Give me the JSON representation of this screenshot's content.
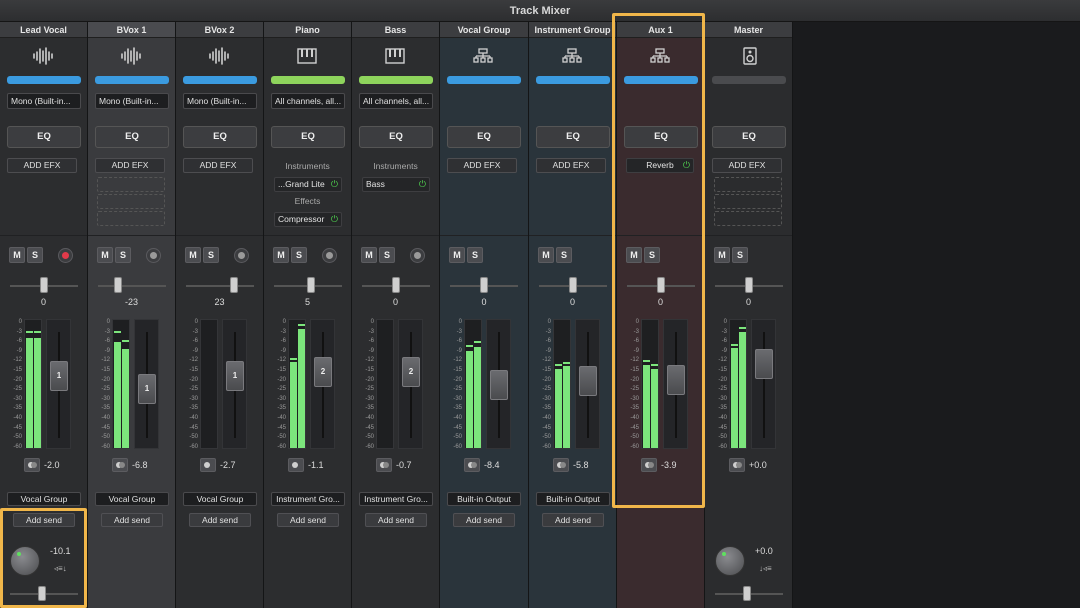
{
  "window": {
    "title": "Track Mixer"
  },
  "colors": {
    "blue": "#3b9be0",
    "green": "#8ed45c",
    "gray": "#4a4b4e",
    "meter": "#7ce57c",
    "highlight": "#f0b64a"
  },
  "scale": [
    "0",
    "-3",
    "-6",
    "-9",
    "-12",
    "-15",
    "-20",
    "-25",
    "-30",
    "-35",
    "-40",
    "-45",
    "-50",
    "-60"
  ],
  "labels": {
    "eq": "EQ",
    "add_efx": "ADD EFX",
    "mute": "M",
    "solo": "S",
    "add_send": "Add send",
    "instruments": "Instruments",
    "effects": "Effects"
  },
  "strips": [
    {
      "name": "Lead Vocal",
      "icon": "waveform-icon",
      "color": "blue",
      "input": "Mono (Built-in...",
      "pan": "0",
      "fader_label": "1",
      "volume": "-2.0",
      "output": "Vocal Group",
      "rec": "armed",
      "meter_l": 0.86,
      "meter_r": 0.86,
      "peak_l": 0.9,
      "peak_r": 0.9,
      "fader_pos": 0.38
    },
    {
      "name": "BVox 1",
      "icon": "waveform-icon",
      "color": "blue",
      "input": "Mono (Built-in...",
      "pan": "-23",
      "fader_label": "1",
      "volume": "-6.8",
      "output": "Vocal Group",
      "rec": "off",
      "meter_l": 0.83,
      "meter_r": 0.77,
      "peak_l": 0.9,
      "peak_r": 0.83,
      "fader_pos": 0.55
    },
    {
      "name": "BVox 2",
      "icon": "waveform-icon",
      "color": "blue",
      "input": "Mono (Built-in...",
      "pan": "23",
      "fader_label": "1",
      "volume": "-2.7",
      "output": "Vocal Group",
      "rec": "off",
      "meter_l": 0,
      "meter_r": 0,
      "peak_l": 0,
      "peak_r": 0,
      "fader_pos": 0.38
    },
    {
      "name": "Piano",
      "icon": "keyboard-icon",
      "color": "green",
      "input": "All channels, all...",
      "pan": "5",
      "fader_label": "2",
      "volume": "-1.1",
      "output": "Instrument Gro...",
      "rec": "off",
      "meter_l": 0.67,
      "meter_r": 0.93,
      "peak_l": 0.69,
      "peak_r": 0.95,
      "fader_pos": 0.33,
      "instruments": [
        "...Grand Lite"
      ],
      "effects": [
        "Compressor"
      ]
    },
    {
      "name": "Bass",
      "icon": "keyboard-icon",
      "color": "green",
      "input": "All channels, all...",
      "pan": "0",
      "fader_label": "2",
      "volume": "-0.7",
      "output": "Instrument Gro...",
      "rec": "off",
      "meter_l": 0,
      "meter_r": 0,
      "peak_l": 0,
      "peak_r": 0,
      "fader_pos": 0.33,
      "instruments": [
        "Bass"
      ]
    },
    {
      "name": "Vocal Group",
      "icon": "group-icon",
      "color": "blue",
      "input": "",
      "pan": "0",
      "fader_label": "",
      "volume": "-8.4",
      "output": "Built-in Output",
      "rec": "",
      "meter_l": 0.76,
      "meter_r": 0.79,
      "peak_l": 0.79,
      "peak_r": 0.82,
      "fader_pos": 0.5
    },
    {
      "name": "Instrument Group",
      "icon": "group-icon",
      "color": "blue",
      "input": "",
      "pan": "0",
      "fader_label": "",
      "volume": "-5.8",
      "output": "Built-in Output",
      "rec": "",
      "meter_l": 0.62,
      "meter_r": 0.64,
      "peak_l": 0.64,
      "peak_r": 0.66,
      "fader_pos": 0.45
    },
    {
      "name": "Aux 1",
      "icon": "group-icon",
      "color": "blue",
      "input": "",
      "pan": "0",
      "fader_label": "",
      "volume": "-3.9",
      "output": "",
      "rec": "",
      "meter_l": 0.65,
      "meter_r": 0.62,
      "peak_l": 0.67,
      "peak_r": 0.64,
      "fader_pos": 0.43,
      "efx": [
        "Reverb"
      ]
    },
    {
      "name": "Master",
      "icon": "speaker-icon",
      "color": "gray",
      "input": "",
      "pan": "0",
      "fader_label": "",
      "volume": "+0.0",
      "output": "",
      "rec": "",
      "meter_l": 0.78,
      "meter_r": 0.91,
      "peak_l": 0.8,
      "peak_r": 0.93,
      "fader_pos": 0.23
    }
  ],
  "send": {
    "level": "-10.1",
    "master_level": "+0.0",
    "mode_pre": "◃≡↓",
    "mode_post": "↓◃≡"
  }
}
